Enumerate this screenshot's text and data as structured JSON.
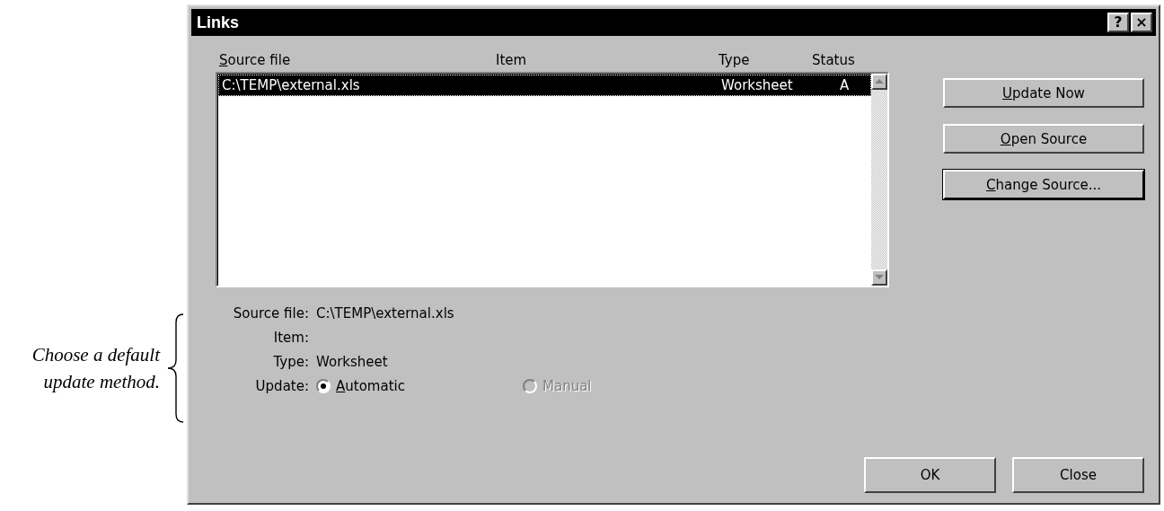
{
  "annotation": {
    "text": "Choose a default update method."
  },
  "window": {
    "title": "Links",
    "help": "?",
    "close": "×"
  },
  "table": {
    "columns": [
      {
        "label": "Source file",
        "mnemonic": true
      },
      {
        "label": "Item",
        "mnemonic": false
      },
      {
        "label": "Type",
        "mnemonic": false
      },
      {
        "label": "Status",
        "mnemonic": false
      }
    ],
    "rows": [
      {
        "source_file": "C:\\TEMP\\external.xls",
        "type": "Worksheet",
        "status": "A",
        "selected": true
      }
    ]
  },
  "side_buttons": [
    {
      "label": "Update Now",
      "mnemonic": true,
      "default": false
    },
    {
      "label": "Open Source",
      "mnemonic": true,
      "default": false
    },
    {
      "label": "Change Source...",
      "mnemonic": true,
      "default": true
    }
  ],
  "details": [
    {
      "label": "Source file:",
      "value": "C:\\TEMP\\external.xls"
    },
    {
      "label": "Item:"
    },
    {
      "label": "Type:",
      "value": "Worksheet"
    }
  ],
  "update": {
    "label": "Update:",
    "options": [
      {
        "label": "Automatic",
        "mnemonic": true,
        "selected": true,
        "disabled": false
      },
      {
        "label": "Manual",
        "mnemonic": false,
        "selected": false,
        "disabled": true
      }
    ]
  },
  "buttons": [
    {
      "label": "OK"
    },
    {
      "label": "Close"
    }
  ]
}
